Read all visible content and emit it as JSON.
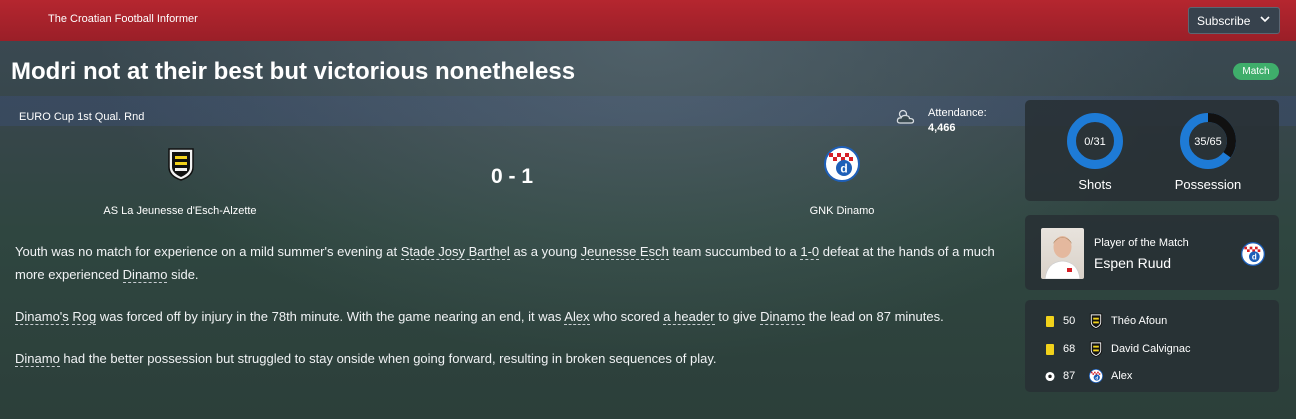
{
  "header": {
    "brand": "The Croatian Football Informer",
    "subscribe_label": "Subscribe"
  },
  "article": {
    "headline": "Modri not at their best but victorious nonetheless",
    "badge": "Match",
    "competition": "EURO Cup 1st Qual. Rnd",
    "attendance_label": "Attendance:",
    "attendance_value": "4,466",
    "weather_icon": "cloudy-icon",
    "score": "0 - 1",
    "home_team": "AS La Jeunesse d'Esch-Alzette",
    "away_team": "GNK Dinamo",
    "paragraphs": [
      {
        "t1": "Youth was no match for experience on a mild summer's evening at ",
        "l1": "Stade Josy Barthel",
        "t2": " as a young ",
        "l2": "Jeunesse Esch",
        "t3": " team succumbed to a ",
        "l3": "1-0",
        "t4": " defeat at the hands of a much more experienced ",
        "l4": "Dinamo",
        "t5": " side."
      },
      {
        "l1": "Dinamo's",
        "t1": " ",
        "l2": "Rog",
        "t2": " was forced off by injury in the 78th minute. With the game nearing an end, it was ",
        "l3": "Alex",
        "t3": " who scored ",
        "l4": "a header",
        "t4": " to give ",
        "l5": "Dinamo",
        "t5": " the lead on 87 minutes."
      },
      {
        "l1": "Dinamo",
        "t1": " had the better possession but struggled to stay onside when going forward, resulting in broken sequences of play."
      }
    ]
  },
  "stats": {
    "shots": {
      "label": "Shots",
      "value_text": "0/31",
      "home": 0,
      "away": 31
    },
    "possession": {
      "label": "Possession",
      "value_text": "35/65",
      "home": 35,
      "away": 65
    },
    "colors": {
      "home": "#111111",
      "away": "#1e7bd6",
      "ring_bg": "#1e7bd6"
    }
  },
  "player_of_match": {
    "label": "Player of the Match",
    "name": "Espen Ruud"
  },
  "events": [
    {
      "type": "yellow-card-icon",
      "minute": "50",
      "team": "home",
      "player": "Théo Afoun"
    },
    {
      "type": "yellow-card-icon",
      "minute": "68",
      "team": "home",
      "player": "David Calvignac"
    },
    {
      "type": "goal-ball-icon",
      "minute": "87",
      "team": "away",
      "player": "Alex"
    }
  ],
  "colors": {
    "topbar": "#b5262f",
    "badge_green": "#3fae6b",
    "yellow_card": "#f2d21b",
    "dinamo_blue": "#1e5fb8"
  }
}
